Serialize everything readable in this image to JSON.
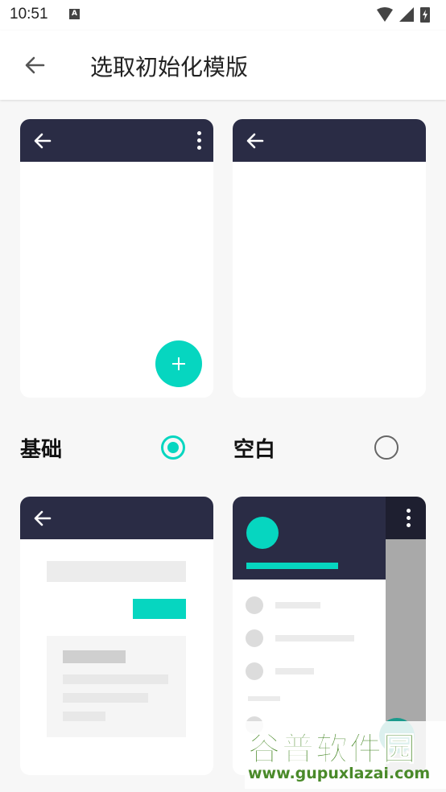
{
  "status_bar": {
    "time": "10:51",
    "notification_badge": "A"
  },
  "app_bar": {
    "title": "选取初始化模版"
  },
  "templates": [
    {
      "label": "基础",
      "selected": true
    },
    {
      "label": "空白",
      "selected": false
    }
  ],
  "watermark": {
    "line1": "谷普软件园",
    "line2": "www.gupuxlazai.com"
  },
  "colors": {
    "accent": "#06d6c0",
    "header_dark": "#2a2c45",
    "background": "#f7f7f7"
  }
}
